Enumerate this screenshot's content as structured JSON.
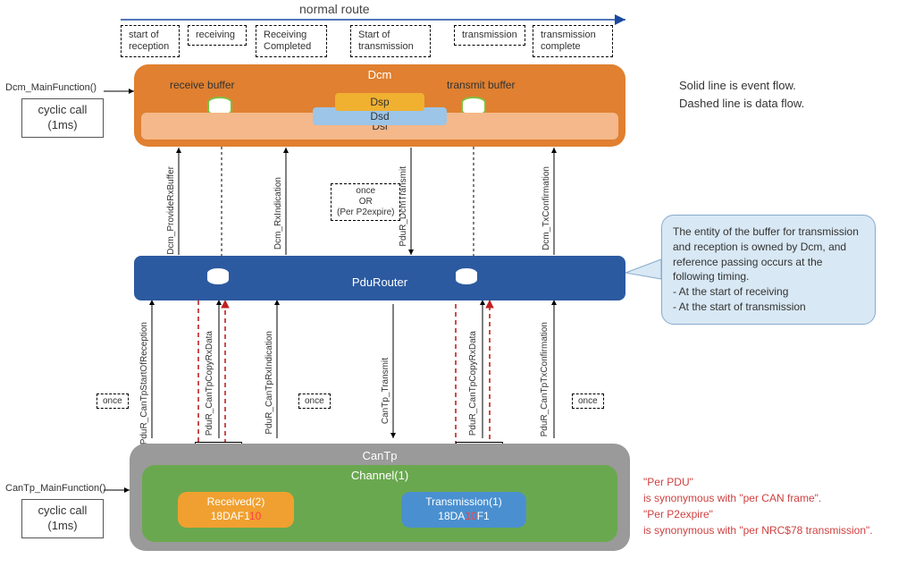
{
  "top_arrow_label": "normal route",
  "phases": {
    "p1": "start of\nreception",
    "p2": "receiving",
    "p3": "Receiving\nCompleted",
    "p4": "Start of\ntransmission",
    "p5": "transmission",
    "p6": "transmission\ncomplete"
  },
  "dcm": {
    "title": "Dcm",
    "recv_buf": "receive buffer",
    "tx_buf": "transmit buffer",
    "dsp": "Dsp",
    "dsd": "Dsd",
    "dsl": "Dsl"
  },
  "pdur": {
    "title": "PduRouter"
  },
  "cantp": {
    "title": "CanTp",
    "channel": "Channel(1)",
    "rx_title": "Received(2)",
    "rx_id_pre": "18DAF1",
    "rx_id_red": "10",
    "tx_title": "Transmission(1)",
    "tx_id_pre": "18DA",
    "tx_id_mid": "10",
    "tx_id_post": "F1"
  },
  "api": {
    "dcm_main": "Dcm_MainFunction()",
    "cantp_main": "CanTp_MainFunction()",
    "dcm_provideRx": "Dcm_ProvideRxBuffer",
    "dcm_rxind": "Dcm_RxIndication",
    "pdur_dcmTx": "PduR_DcmTransmit",
    "dcm_txconf": "Dcm_TxConfirmation",
    "pdur_startRx": "PduR_CanTpStartOfReception",
    "pdur_copyRx": "PduR_CanTpCopyRxData",
    "pdur_rxind": "PduR_CanTpRxIndication",
    "cantp_tx": "CanTp_Transmit",
    "pdur_copyTx": "PduR_CanTpCopyRxData",
    "pdur_txconf": "PduR_CanTpTxConfirmation"
  },
  "tags": {
    "once": "once",
    "perpdu": "Per PDU",
    "once_or_p2": "once\nOR\n(Per P2expire)"
  },
  "cyclic": {
    "label": "cyclic call",
    "period": "(1ms)"
  },
  "legend": {
    "l1": "Solid line is event flow.",
    "l2": "Dashed line is data flow."
  },
  "balloon": "The entity of the buffer for transmission and reception is owned by Dcm, and reference passing occurs at the following timing.\n- At the start of receiving\n- At the start of transmission",
  "rednote": {
    "r1": "\"Per PDU\"",
    "r2": " is synonymous with \"per CAN frame\".",
    "r3": "\"Per P2expire\"",
    "r4": " is synonymous with \"per NRC$78 transmission\"."
  }
}
